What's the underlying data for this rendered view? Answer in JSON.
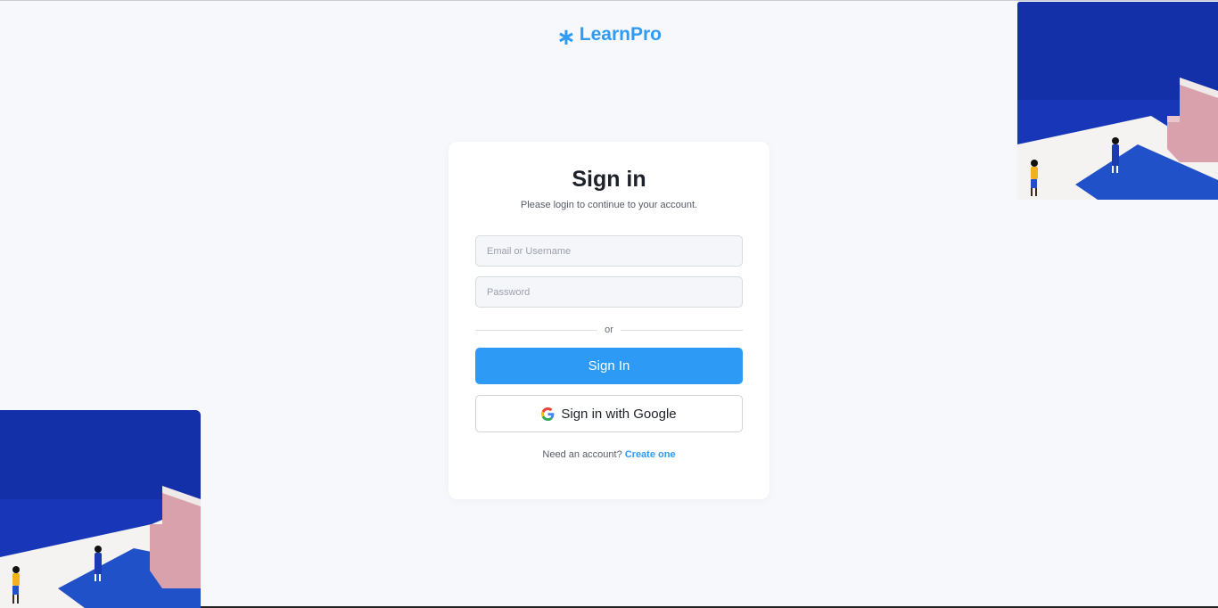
{
  "brand": {
    "icon": "asterisk-icon",
    "icon_glyph": "∗",
    "name": "LearnPro",
    "color": "#2f9bf5"
  },
  "login": {
    "title": "Sign in",
    "subtitle": "Please login to continue to your account.",
    "email_placeholder": "Email or Username",
    "password_placeholder": "Password",
    "divider_text": "or",
    "signin_label": "Sign In",
    "google_label": "Sign in with Google",
    "footer_text": "Need an account?",
    "footer_link": "Create one"
  },
  "colors": {
    "primary": "#2d9bf6",
    "background": "#f7f8fc",
    "illustration_blue": "#1534b0",
    "illustration_pink": "#d9a1ab"
  }
}
